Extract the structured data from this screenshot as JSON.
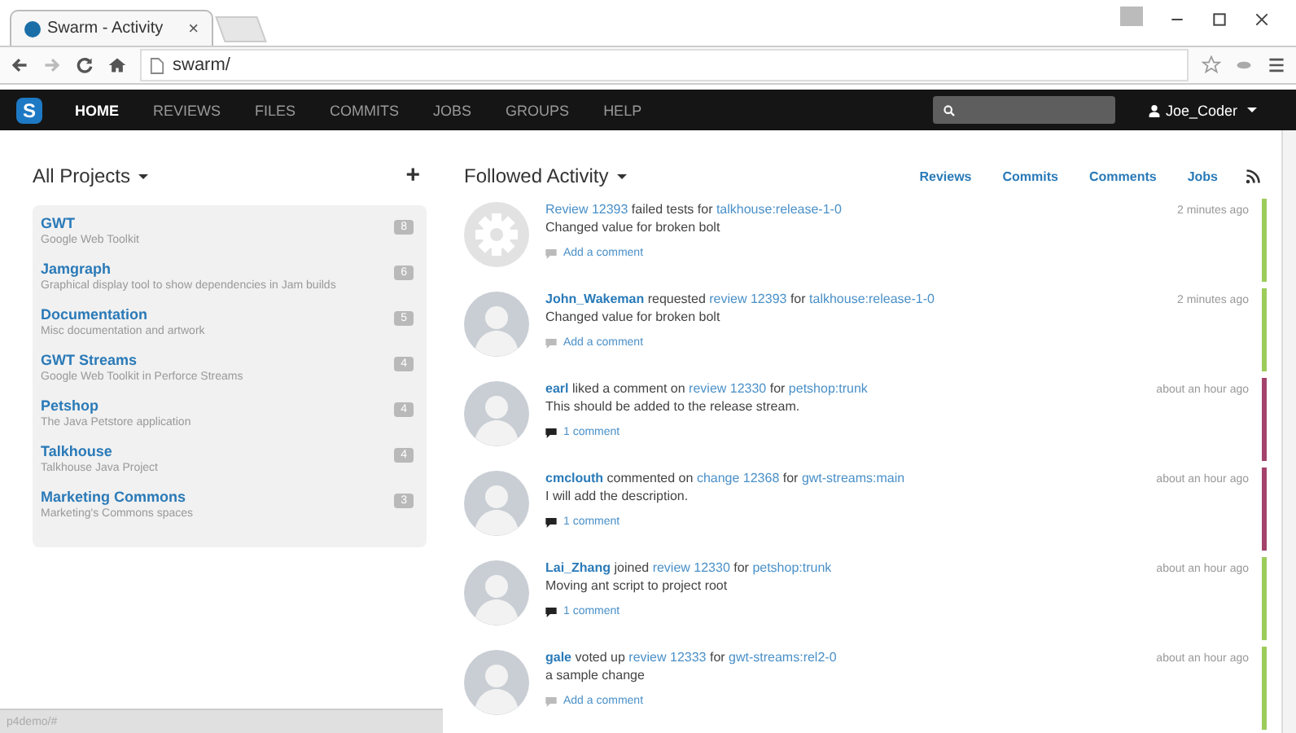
{
  "browser": {
    "tab_title": "Swarm - Activity",
    "tab_close": "×",
    "url": "swarm/"
  },
  "nav": {
    "logo": "S",
    "items": [
      {
        "label": "HOME",
        "selected": true
      },
      {
        "label": "REVIEWS",
        "selected": false
      },
      {
        "label": "FILES",
        "selected": false
      },
      {
        "label": "COMMITS",
        "selected": false
      },
      {
        "label": "JOBS",
        "selected": false
      },
      {
        "label": "GROUPS",
        "selected": false
      },
      {
        "label": "HELP",
        "selected": false
      }
    ],
    "user": "Joe_Coder"
  },
  "projects": {
    "title": "All Projects",
    "add": "+",
    "items": [
      {
        "name": "GWT",
        "description": "Google Web Toolkit",
        "count": "8"
      },
      {
        "name": "Jamgraph",
        "description": "Graphical display tool to show dependencies in Jam builds",
        "count": "6"
      },
      {
        "name": "Documentation",
        "description": "Misc documentation and artwork",
        "count": "5"
      },
      {
        "name": "GWT Streams",
        "description": "Google Web Toolkit in Perforce Streams",
        "count": "4"
      },
      {
        "name": "Petshop",
        "description": "The Java Petstore application",
        "count": "4"
      },
      {
        "name": "Talkhouse",
        "description": "Talkhouse Java Project",
        "count": "4"
      },
      {
        "name": "Marketing Commons",
        "description": "Marketing's Commons spaces",
        "count": "3"
      }
    ]
  },
  "activity": {
    "title": "Followed Activity",
    "filters": [
      "Reviews",
      "Commits",
      "Comments",
      "Jobs"
    ],
    "items": [
      {
        "kind": "system",
        "headline": [
          {
            "kind": "link",
            "text": "Review 12393"
          },
          {
            "kind": "plain",
            "text": " failed tests for "
          },
          {
            "kind": "link",
            "text": "talkhouse:release-1-0"
          }
        ],
        "description": "Changed value for broken bolt",
        "comments": "Add a comment",
        "has_comments": false,
        "time": "2 minutes ago",
        "color": "#9ccc5a"
      },
      {
        "kind": "user",
        "headline": [
          {
            "kind": "user",
            "text": "John_Wakeman"
          },
          {
            "kind": "plain",
            "text": " requested "
          },
          {
            "kind": "link",
            "text": "review 12393"
          },
          {
            "kind": "plain",
            "text": " for "
          },
          {
            "kind": "link",
            "text": "talkhouse:release-1-0"
          }
        ],
        "description": "Changed value for broken bolt",
        "comments": "Add a comment",
        "has_comments": false,
        "time": "2 minutes ago",
        "color": "#9ccc5a"
      },
      {
        "kind": "user",
        "headline": [
          {
            "kind": "user",
            "text": "earl"
          },
          {
            "kind": "plain",
            "text": " liked a comment on "
          },
          {
            "kind": "link",
            "text": "review 12330"
          },
          {
            "kind": "plain",
            "text": " for "
          },
          {
            "kind": "link",
            "text": "petshop:trunk"
          }
        ],
        "description": "This should be added to the release stream.",
        "comments": "1 comment",
        "has_comments": true,
        "time": "about an hour ago",
        "color": "#a3436b"
      },
      {
        "kind": "user",
        "headline": [
          {
            "kind": "user",
            "text": "cmclouth"
          },
          {
            "kind": "plain",
            "text": " commented on "
          },
          {
            "kind": "link",
            "text": "change 12368"
          },
          {
            "kind": "plain",
            "text": " for "
          },
          {
            "kind": "link",
            "text": "gwt-streams:main"
          }
        ],
        "description": "I will add the description.",
        "comments": "1 comment",
        "has_comments": true,
        "time": "about an hour ago",
        "color": "#a3436b"
      },
      {
        "kind": "user",
        "headline": [
          {
            "kind": "user",
            "text": "Lai_Zhang"
          },
          {
            "kind": "plain",
            "text": " joined "
          },
          {
            "kind": "link",
            "text": "review 12330"
          },
          {
            "kind": "plain",
            "text": " for "
          },
          {
            "kind": "link",
            "text": "petshop:trunk"
          }
        ],
        "description": "Moving ant script to project root",
        "comments": "1 comment",
        "has_comments": true,
        "time": "about an hour ago",
        "color": "#9ccc5a"
      },
      {
        "kind": "user",
        "headline": [
          {
            "kind": "user",
            "text": "gale"
          },
          {
            "kind": "plain",
            "text": " voted up "
          },
          {
            "kind": "link",
            "text": "review 12333"
          },
          {
            "kind": "plain",
            "text": " for "
          },
          {
            "kind": "link",
            "text": "gwt-streams:rel2-0"
          }
        ],
        "description": "a sample change",
        "comments": "Add a comment",
        "has_comments": false,
        "time": "about an hour ago",
        "color": "#9ccc5a"
      }
    ]
  },
  "status_bar": "p4demo/#"
}
